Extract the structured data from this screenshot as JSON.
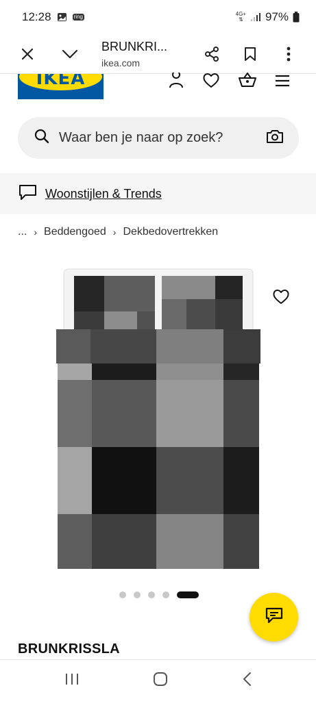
{
  "status_bar": {
    "time": "12:28",
    "ring_label": "ring",
    "network": "4G+",
    "battery": "97%"
  },
  "browser": {
    "title": "BRUNKRI...",
    "domain": "ikea.com"
  },
  "logo": {
    "text": "IKEA",
    "blue": "#0058a3",
    "yellow": "#ffdb00"
  },
  "header_icons": [
    "profile-icon",
    "heart-icon",
    "basket-icon",
    "menu-icon"
  ],
  "search": {
    "placeholder": "Waar ben je naar op zoek?"
  },
  "trends": {
    "label": "Woonstijlen & Trends"
  },
  "breadcrumb": {
    "ellipsis": "...",
    "items": [
      "Beddengoed",
      "Dekbedovertrekken"
    ]
  },
  "carousel": {
    "count": 5,
    "active_index": 4
  },
  "product": {
    "name": "BRUNKRISSLA"
  },
  "colors": {
    "accent_yellow": "#ffdb00",
    "ikea_blue": "#0058a3"
  }
}
